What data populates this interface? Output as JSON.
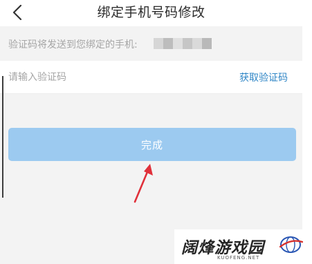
{
  "header": {
    "title": "绑定手机号码修改",
    "back_icon": "chevron-left-icon"
  },
  "notice": {
    "text": "验证码将发送到您绑定的手机:"
  },
  "code_field": {
    "placeholder": "请输入验证码",
    "value": "",
    "get_code_label": "获取验证码"
  },
  "done_button": {
    "label": "完成"
  },
  "watermark": {
    "title": "阔烽游戏园",
    "subtitle": "KUOFENG.NET"
  },
  "colors": {
    "accent_link": "#2f86c6",
    "button_bg": "#9ccaf0",
    "arrow": "#e0303a",
    "page_bg": "#f3f3f3"
  }
}
